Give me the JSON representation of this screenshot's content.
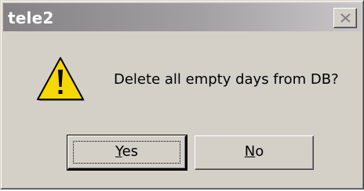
{
  "window": {
    "title": "tele2"
  },
  "dialog": {
    "message": "Delete all empty days from DB?",
    "icon": "warning-icon"
  },
  "buttons": {
    "yes": {
      "mnemonic": "Y",
      "rest": "es"
    },
    "no": {
      "mnemonic": "N",
      "rest": "o"
    }
  },
  "colors": {
    "titlebar_start": "#848284",
    "titlebar_end": "#c8c6c8",
    "face": "#d4d0c8",
    "warning_yellow": "#f5d800"
  }
}
